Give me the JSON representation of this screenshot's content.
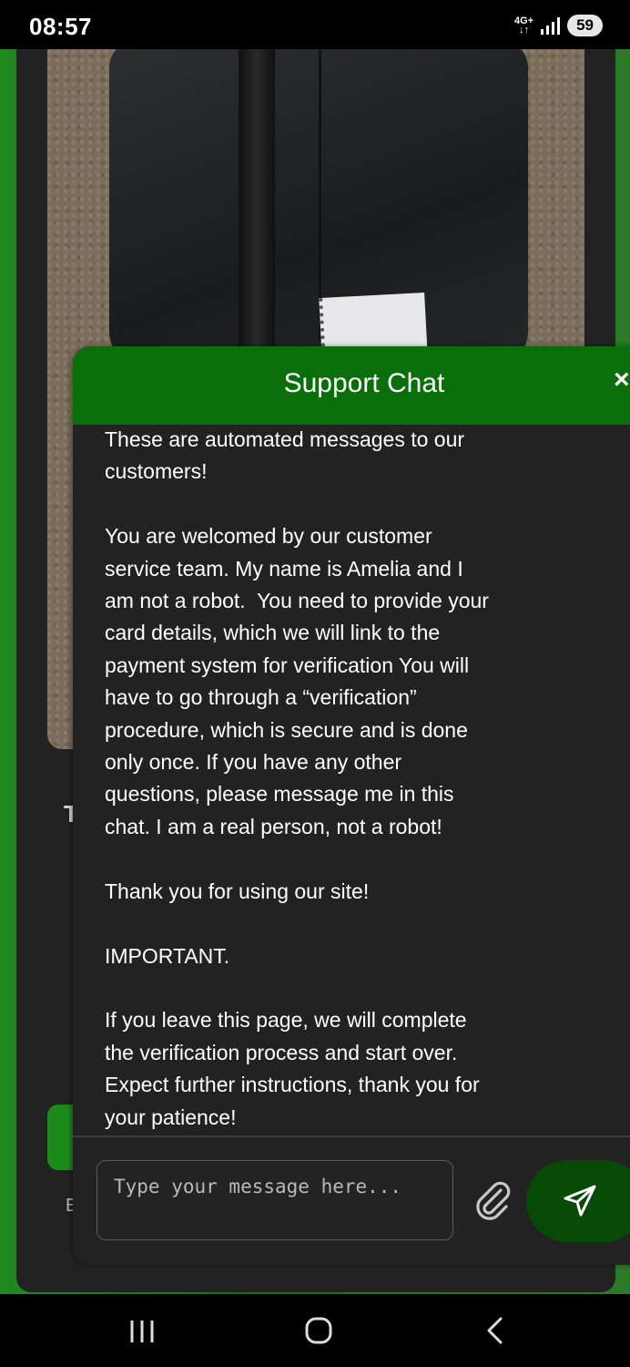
{
  "status_bar": {
    "time": "08:57",
    "network": "4G+",
    "battery": "59"
  },
  "background": {
    "heading_fragment": "T",
    "text_fragment": "E"
  },
  "chat": {
    "title": "Support Chat",
    "close_label": "×",
    "message": "These are automated messages to our customers!\n\nYou are welcomed by our customer service team. My name is Amelia and I am not a robot.  You need to provide your card details, which we will link to the payment system for verification You will have to go through a “verification” procedure, which is secure and is done only once. If you have any other questions, please message me in this chat. I am a real person, not a robot!\n\nThank you for using our site!\n\nIMPORTANT.\n\nIf you leave this page, we will complete the verification process and start over. Expect further instructions, thank you for your patience!",
    "input_placeholder": "Type your message here...",
    "input_value": "",
    "attach_icon": "paperclip-icon",
    "send_icon": "send-icon"
  },
  "colors": {
    "header_green": "#0a6e0a",
    "send_button": "#064a06",
    "panel_bg": "#222222"
  }
}
